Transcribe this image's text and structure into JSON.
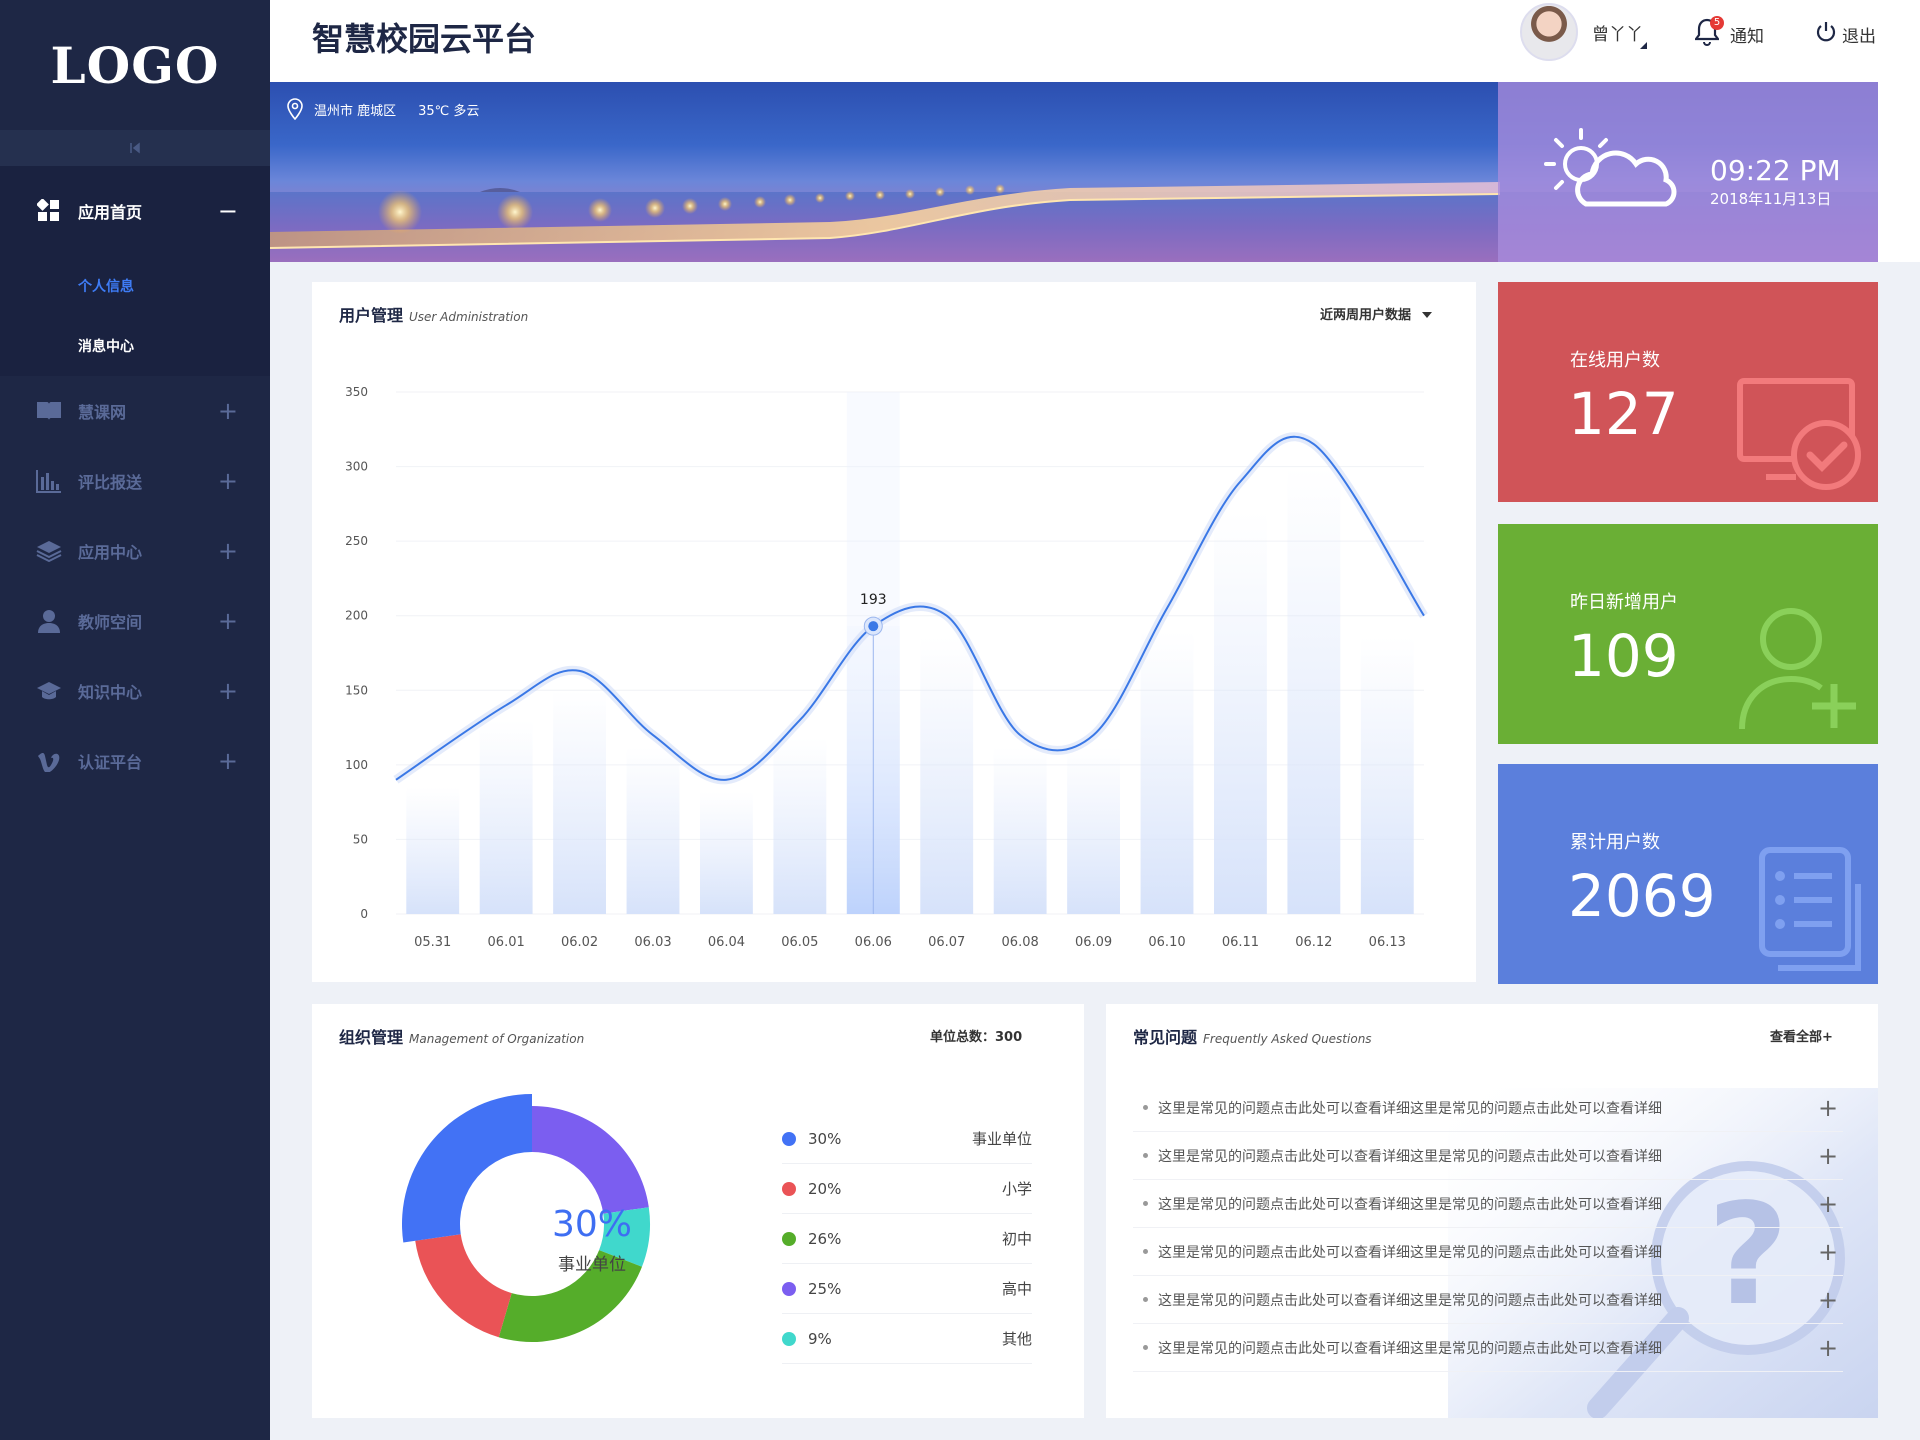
{
  "sidebar": {
    "logo": "LOGO",
    "collapse_icon": "collapse-icon",
    "home": {
      "label": "应用首页",
      "toggle": "−",
      "icon": "grid-icon"
    },
    "sub_items": [
      {
        "label": "个人信息",
        "active": true
      },
      {
        "label": "消息中心",
        "active": false
      }
    ],
    "items": [
      {
        "label": "慧课网",
        "icon": "book-icon",
        "toggle": "+"
      },
      {
        "label": "评比报送",
        "icon": "bar-chart-icon",
        "toggle": "+"
      },
      {
        "label": "应用中心",
        "icon": "layers-icon",
        "toggle": "+"
      },
      {
        "label": "教师空间",
        "icon": "user-icon",
        "toggle": "+"
      },
      {
        "label": "知识中心",
        "icon": "graduation-cap-icon",
        "toggle": "+"
      },
      {
        "label": "认证平台",
        "icon": "vimeo-icon",
        "toggle": "+"
      }
    ]
  },
  "header": {
    "title": "智慧校园云平台",
    "username": "曾丫丫",
    "notify_badge": "5",
    "notify_label": "通知",
    "logout_label": "退出"
  },
  "banner": {
    "location": "温州市 鹿城区",
    "weather": "35℃ 多云",
    "time": "09:22 PM",
    "date": "2018年11月13日"
  },
  "user_admin": {
    "title": "用户管理",
    "title_en": "User Administration",
    "filter": "近两周用户数据"
  },
  "chart_data": {
    "type": "line",
    "categories": [
      "05.31",
      "06.01",
      "06.02",
      "06.03",
      "06.04",
      "06.05",
      "06.06",
      "06.07",
      "06.08",
      "06.09",
      "06.10",
      "06.11",
      "06.12",
      "06.13"
    ],
    "values": [
      90,
      140,
      163,
      120,
      90,
      130,
      193,
      200,
      120,
      120,
      205,
      290,
      315,
      200
    ],
    "bar_values": [
      85,
      130,
      150,
      112,
      82,
      118,
      193,
      186,
      112,
      112,
      190,
      270,
      300,
      186
    ],
    "ylim": [
      0,
      350
    ],
    "yticks": [
      0,
      50,
      100,
      150,
      200,
      250,
      300,
      350
    ],
    "highlight_index": 6,
    "highlight_label": "193",
    "grid": true,
    "line_color": "#3a78e6"
  },
  "stats": [
    {
      "label": "在线用户数",
      "value": "127",
      "color": "#d05458",
      "icon": "monitor-check-icon"
    },
    {
      "label": "昨日新增用户",
      "value": "109",
      "color": "#6aaf35",
      "icon": "add-user-icon"
    },
    {
      "label": "累计用户数",
      "value": "2069",
      "color": "#5b7fdc",
      "icon": "document-list-icon"
    }
  ],
  "org": {
    "title": "组织管理",
    "title_en": "Management of Organization",
    "total_label": "单位总数：300",
    "center_value": "30%",
    "center_label": "事业单位",
    "segments": [
      {
        "pct": "30%",
        "name": "事业单位",
        "value": 30,
        "color": "#4272f5"
      },
      {
        "pct": "20%",
        "name": "小学",
        "value": 20,
        "color": "#ea5356"
      },
      {
        "pct": "26%",
        "name": "初中",
        "value": 26,
        "color": "#55ad2a"
      },
      {
        "pct": "25%",
        "name": "高中",
        "value": 25,
        "color": "#7b5ef0"
      },
      {
        "pct": "9%",
        "name": "其他",
        "value": 9,
        "color": "#40d8cc"
      }
    ]
  },
  "faq": {
    "title": "常见问题",
    "title_en": "Frequently Asked Questions",
    "view_all": "查看全部+",
    "items": [
      "这里是常见的问题点击此处可以查看详细这里是常见的问题点击此处可以查看详细",
      "这里是常见的问题点击此处可以查看详细这里是常见的问题点击此处可以查看详细",
      "这里是常见的问题点击此处可以查看详细这里是常见的问题点击此处可以查看详细",
      "这里是常见的问题点击此处可以查看详细这里是常见的问题点击此处可以查看详细",
      "这里是常见的问题点击此处可以查看详细这里是常见的问题点击此处可以查看详细",
      "这里是常见的问题点击此处可以查看详细这里是常见的问题点击此处可以查看详细"
    ]
  }
}
